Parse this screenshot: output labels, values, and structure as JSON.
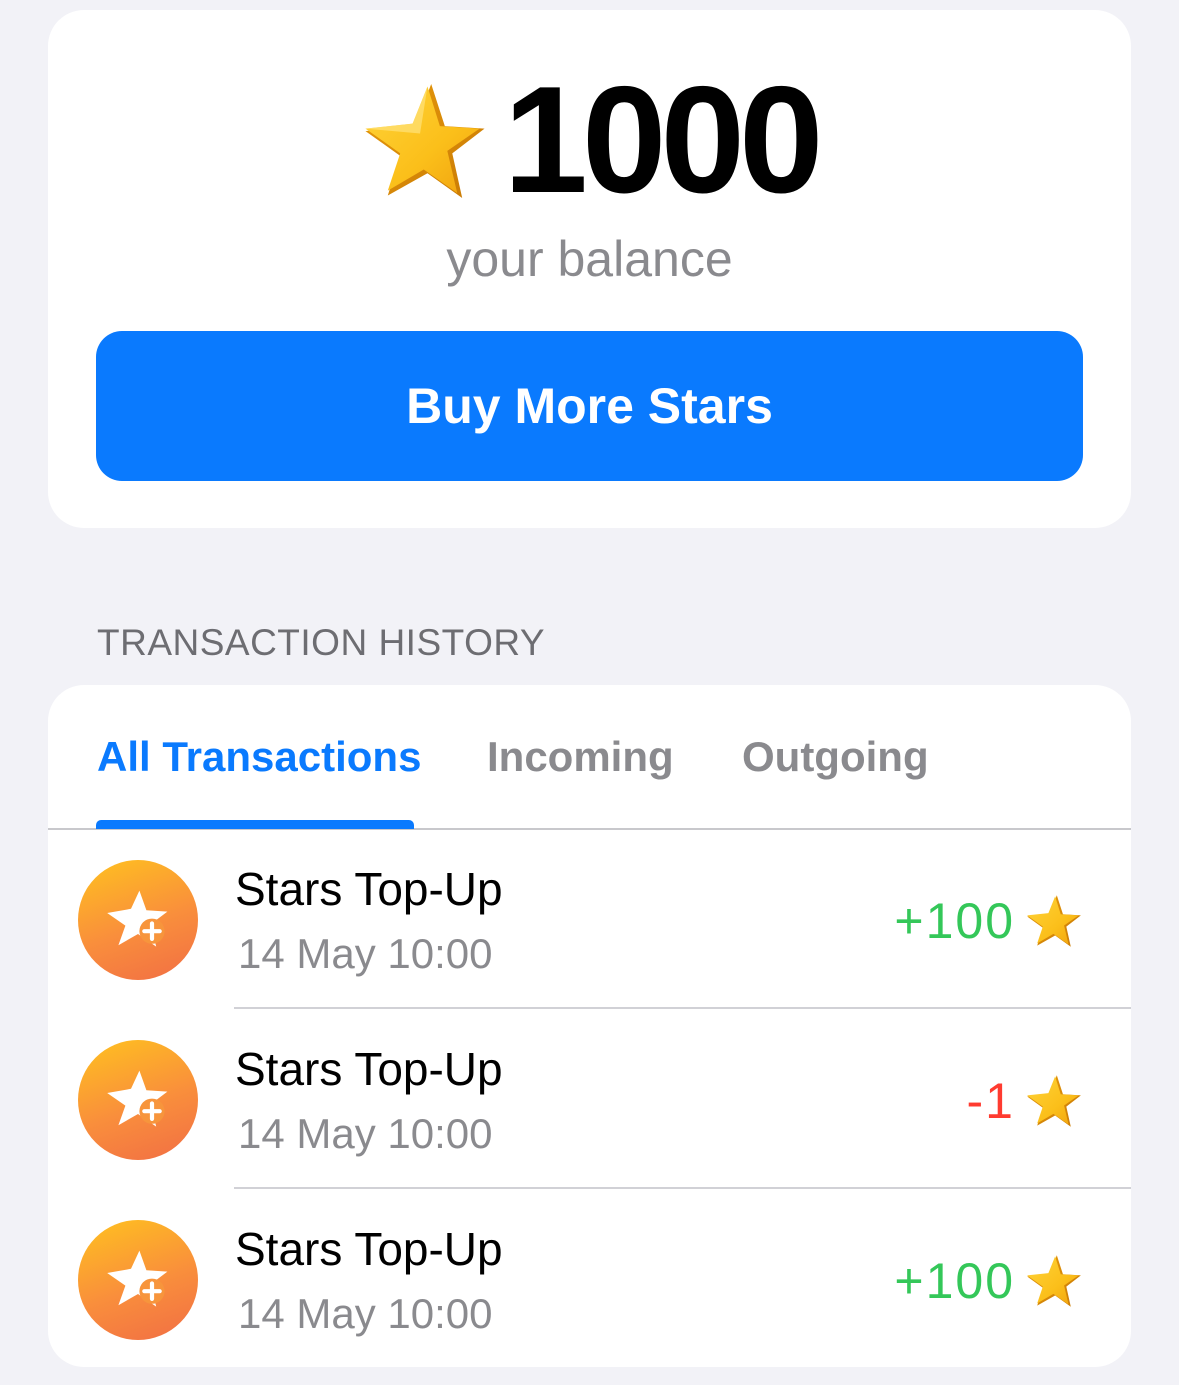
{
  "balance": {
    "amount": "1000",
    "caption": "your balance",
    "buy_button": "Buy More Stars",
    "star_icon": "star-icon"
  },
  "history": {
    "section_title": "TRANSACTION HISTORY",
    "tabs": [
      {
        "label": "All Transactions",
        "active": true
      },
      {
        "label": "Incoming",
        "active": false
      },
      {
        "label": "Outgoing",
        "active": false
      }
    ],
    "transactions": [
      {
        "title": "Stars Top-Up",
        "date": "14 May 10:00",
        "amount": "+100",
        "direction": "plus",
        "icon": "star-plus-icon"
      },
      {
        "title": "Stars Top-Up",
        "date": "14 May 10:00",
        "amount": "-1",
        "direction": "minus",
        "icon": "star-plus-icon"
      },
      {
        "title": "Stars Top-Up",
        "date": "14 May 10:00",
        "amount": "+100",
        "direction": "plus",
        "icon": "star-plus-icon"
      }
    ]
  },
  "colors": {
    "accent": "#0a7afe",
    "positive": "#34c759",
    "negative": "#ff3b30",
    "background": "#f2f2f7",
    "secondary_text": "#8a8a8e"
  }
}
